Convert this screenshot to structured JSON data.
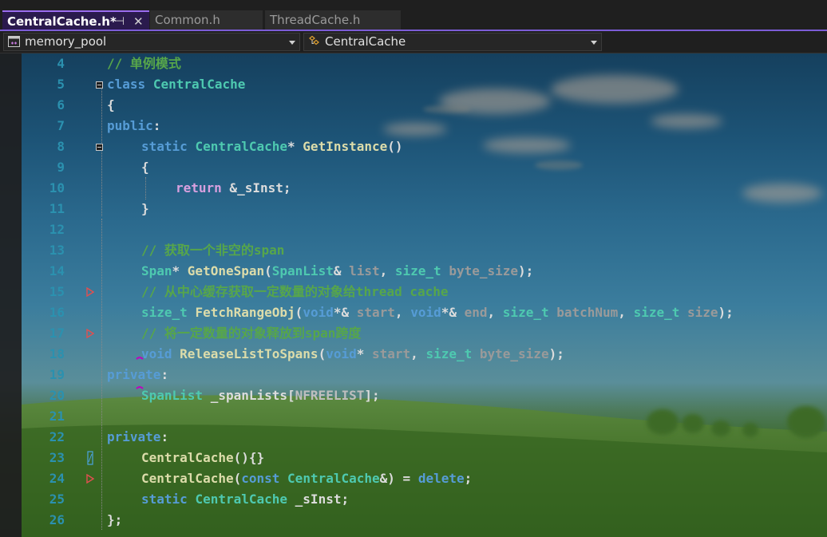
{
  "tabs": [
    {
      "label": "CentralCache.h*",
      "active": true
    },
    {
      "label": "Common.h",
      "active": false
    },
    {
      "label": "ThreadCache.h",
      "active": false
    }
  ],
  "tab_icons": {
    "pin": "⊣",
    "close": "✕"
  },
  "navbar": {
    "project": "memory_pool",
    "scope": "CentralCache",
    "project_icon": "project-icon",
    "scope_icon": "class-icon"
  },
  "colors": {
    "line_number": "#2b91af",
    "keyword": "#569cd6",
    "type": "#4ec9b0",
    "function": "#dcdcaa",
    "control": "#d8a0df",
    "comment": "#57a64a",
    "accent": "#7c5cd6"
  },
  "editor": {
    "lines": [
      {
        "n": "4",
        "text": "// 单例模式"
      },
      {
        "n": "5",
        "text": "class CentralCache"
      },
      {
        "n": "6",
        "text": "{"
      },
      {
        "n": "7",
        "text": "public:"
      },
      {
        "n": "8",
        "text": "static CentralCache* GetInstance()"
      },
      {
        "n": "9",
        "text": "{"
      },
      {
        "n": "10",
        "text": "return &_sInst;"
      },
      {
        "n": "11",
        "text": "}"
      },
      {
        "n": "12",
        "text": ""
      },
      {
        "n": "13",
        "text": "// 获取一个非空的span"
      },
      {
        "n": "14",
        "text": "Span* GetOneSpan(SpanList& list, size_t byte_size);"
      },
      {
        "n": "15",
        "text": "// 从中心缓存获取一定数量的对象给thread cache"
      },
      {
        "n": "16",
        "text": "size_t FetchRangeObj(void*& start, void*& end, size_t batchNum, size_t size);"
      },
      {
        "n": "17",
        "text": "// 将一定数量的对象释放到span跨度"
      },
      {
        "n": "18",
        "text": "void ReleaseListToSpans(void* start, size_t byte_size);"
      },
      {
        "n": "19",
        "text": "private:"
      },
      {
        "n": "20",
        "text": "SpanList _spanLists[NFREELIST];"
      },
      {
        "n": "21",
        "text": ""
      },
      {
        "n": "22",
        "text": "private:"
      },
      {
        "n": "23",
        "text": "CentralCache(){}"
      },
      {
        "n": "24",
        "text": "CentralCache(const CentralCache&) = delete;"
      },
      {
        "n": "25",
        "text": "static CentralCache _sInst;"
      },
      {
        "n": "26",
        "text": "};"
      }
    ]
  }
}
